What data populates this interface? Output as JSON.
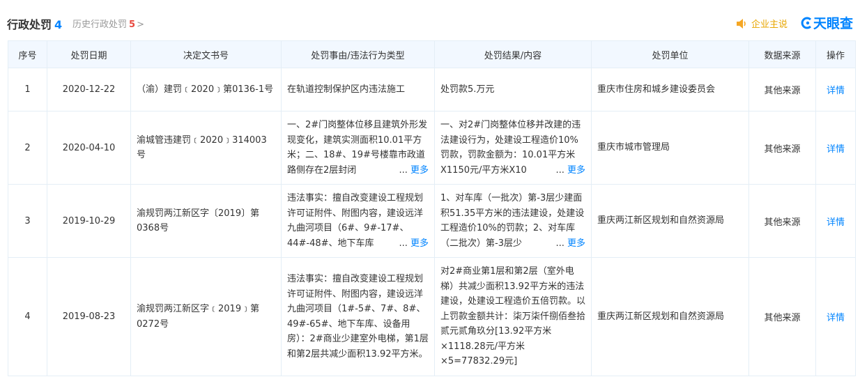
{
  "header": {
    "title": "行政处罚",
    "count": "4",
    "history_label": "历史行政处罚",
    "history_count": "5",
    "chevron": ">",
    "enterprise_say": "企业主说",
    "brand": "天眼查"
  },
  "table": {
    "columns": [
      "序号",
      "处罚日期",
      "决定文书号",
      "处罚事由/违法行为类型",
      "处罚结果/内容",
      "处罚单位",
      "数据来源",
      "操作"
    ],
    "more_label": "更多",
    "ellipsis": "...",
    "rows": [
      {
        "index": "1",
        "date": "2020-12-22",
        "doc_no": "（渝）建罚﹝2020﹞第0136-1号",
        "reason": "在轨道控制保护区内违法施工",
        "result": "处罚款5.万元",
        "unit": "重庆市住房和城乡建设委员会",
        "source": "其他来源",
        "action": "详情"
      },
      {
        "index": "2",
        "date": "2020-04-10",
        "doc_no": "渝城管违建罚﹝2020﹞314003号",
        "reason": "一、2#门岗整体位移且建筑外形发现变化，建筑实测面积10.01平方米；二、18#、19#号楼靠市政道路侧存在2层封闭",
        "result": "一、对2#门岗整体位移并改建的违法建设行为，处建设工程造价10%罚款，罚款金额为：10.01平方米X1150元/平方米X10",
        "unit": "重庆市城市管理局",
        "source": "其他来源",
        "action": "详情"
      },
      {
        "index": "3",
        "date": "2019-10-29",
        "doc_no": "渝规罚两江新区字〔2019〕第0368号",
        "reason": "违法事实：擅自改变建设工程规划许可证附件、附图内容，建设远洋九曲河项目（6#、9#-17#、44#-48#、地下车库",
        "result": "1、对车库（一批次）第-3层少建面积51.35平方米的违法建设，处建设工程造价10%的罚款；2、对车库（二批次）第-3层少",
        "unit": "重庆两江新区规划和自然资源局",
        "source": "其他来源",
        "action": "详情"
      },
      {
        "index": "4",
        "date": "2019-08-23",
        "doc_no": "渝规罚两江新区字﹝2019﹞第0272号",
        "reason": "违法事实：擅自改变建设工程规划许可证附件、附图内容，建设远洋九曲河项目（1#-5#、7#、8#、49#-65#、地下车库、设备用房）：2#商业少建室外电梯，第1层和第2层共减少面积13.92平方米。",
        "result": "对2#商业第1层和第2层（室外电梯）共减少面积13.92平方米的违法建设，处建设工程造价五倍罚款。以上罚款金额共计：柒万柒仟捌佰叁拾贰元贰角玖分[13.92平方米×1118.28元/平方米×5=77832.29元]",
        "unit": "重庆两江新区规划和自然资源局",
        "source": "其他来源",
        "action": "详情"
      }
    ]
  },
  "colors": {
    "accent": "#0084ff",
    "danger": "#e8483e",
    "header_bg": "#f2f8ff",
    "border": "#e4eef6",
    "gold": "#e8a600"
  },
  "icons": {
    "speaker": "speaker-icon",
    "brand_logo": "tianyancha-logo-icon",
    "chevron": "chevron-right-icon"
  }
}
